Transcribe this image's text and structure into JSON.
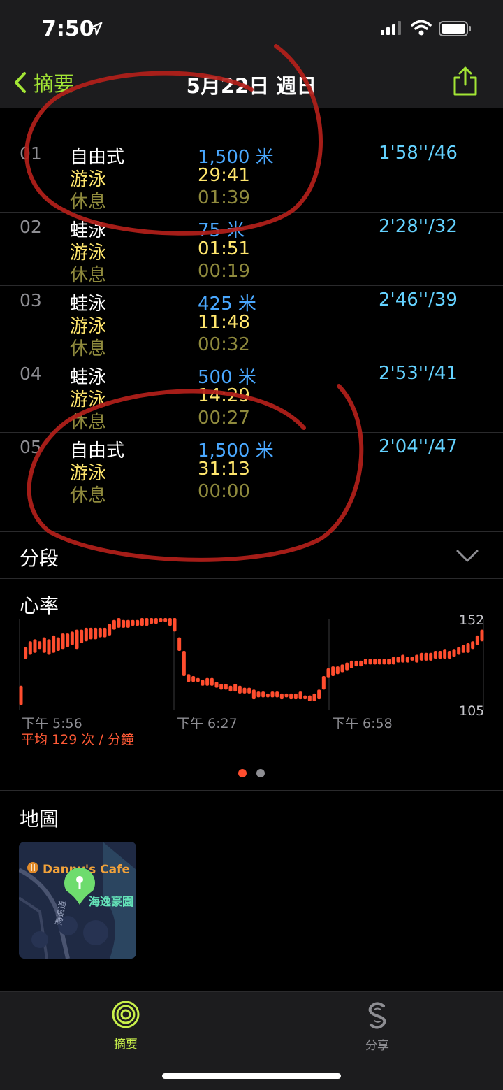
{
  "status": {
    "time": "7:50"
  },
  "nav": {
    "back_label": "摘要",
    "title": "5月22日 週日"
  },
  "laps": [
    {
      "num": "01",
      "stroke": "自由式",
      "distance": "1,500 米",
      "swim_label": "游泳",
      "swim_time": "29:41",
      "rest_label": "休息",
      "rest_time": "01:39",
      "pace": "1'58''/46"
    },
    {
      "num": "02",
      "stroke": "蛙泳",
      "distance": "75 米",
      "swim_label": "游泳",
      "swim_time": "01:51",
      "rest_label": "休息",
      "rest_time": "00:19",
      "pace": "2'28''/32"
    },
    {
      "num": "03",
      "stroke": "蛙泳",
      "distance": "425 米",
      "swim_label": "游泳",
      "swim_time": "11:48",
      "rest_label": "休息",
      "rest_time": "00:32",
      "pace": "2'46''/39"
    },
    {
      "num": "04",
      "stroke": "蛙泳",
      "distance": "500 米",
      "swim_label": "游泳",
      "swim_time": "14:29",
      "rest_label": "休息",
      "rest_time": "00:27",
      "pace": "2'53''/41"
    },
    {
      "num": "05",
      "stroke": "自由式",
      "distance": "1,500 米",
      "swim_label": "游泳",
      "swim_time": "31:13",
      "rest_label": "休息",
      "rest_time": "00:00",
      "pace": "2'04''/47"
    }
  ],
  "segments": {
    "label": "分段"
  },
  "heart_rate": {
    "title": "心率",
    "max_label": "152",
    "min_label": "105",
    "ticks": [
      "下午 5:56",
      "下午 6:27",
      "下午 6:58"
    ],
    "average": "平均 129 次 / 分鐘",
    "color": "#ff4d2e"
  },
  "chart_data": {
    "type": "bar",
    "title": "心率",
    "ylim": [
      105,
      152
    ],
    "ytick_labels": [
      "152",
      "105"
    ],
    "xtick_labels": [
      "下午 5:56",
      "下午 6:27",
      "下午 6:58"
    ],
    "series": [
      {
        "ranges": [
          [
            107,
            117
          ],
          [
            131,
            137
          ],
          [
            133,
            140
          ],
          [
            134,
            141
          ],
          [
            136,
            140
          ],
          [
            134,
            142
          ],
          [
            133,
            141
          ],
          [
            134,
            143
          ],
          [
            135,
            142
          ],
          [
            136,
            144
          ],
          [
            137,
            144
          ],
          [
            138,
            145
          ],
          [
            136,
            146
          ],
          [
            139,
            146
          ],
          [
            140,
            147
          ],
          [
            141,
            147
          ],
          [
            141,
            147
          ],
          [
            142,
            147
          ],
          [
            142,
            147
          ],
          [
            143,
            149
          ],
          [
            146,
            151
          ],
          [
            147,
            152
          ],
          [
            147,
            151
          ],
          [
            147,
            151
          ],
          [
            148,
            151
          ],
          [
            148,
            151
          ],
          [
            148,
            152
          ],
          [
            148,
            152
          ],
          [
            149,
            152
          ],
          [
            149,
            152
          ],
          [
            150,
            152
          ],
          [
            150,
            152
          ],
          [
            148,
            152
          ],
          [
            145,
            152
          ],
          [
            135,
            142
          ],
          [
            122,
            135
          ],
          [
            119,
            123
          ],
          [
            119,
            122
          ],
          [
            119,
            121
          ],
          [
            117,
            120
          ],
          [
            117,
            121
          ],
          [
            117,
            121
          ],
          [
            116,
            119
          ],
          [
            115,
            118
          ],
          [
            115,
            118
          ],
          [
            114,
            117
          ],
          [
            114,
            118
          ],
          [
            113,
            117
          ],
          [
            113,
            116
          ],
          [
            113,
            116
          ],
          [
            110,
            115
          ],
          [
            111,
            114
          ],
          [
            111,
            114
          ],
          [
            111,
            113
          ],
          [
            111,
            114
          ],
          [
            111,
            114
          ],
          [
            110,
            113
          ],
          [
            111,
            113
          ],
          [
            110,
            113
          ],
          [
            110,
            113
          ],
          [
            110,
            114
          ],
          [
            110,
            112
          ],
          [
            109,
            112
          ],
          [
            109,
            113
          ],
          [
            110,
            115
          ],
          [
            115,
            122
          ],
          [
            121,
            126
          ],
          [
            122,
            127
          ],
          [
            123,
            127
          ],
          [
            124,
            128
          ],
          [
            125,
            129
          ],
          [
            126,
            130
          ],
          [
            127,
            130
          ],
          [
            127,
            130
          ],
          [
            128,
            131
          ],
          [
            128,
            131
          ],
          [
            128,
            131
          ],
          [
            128,
            131
          ],
          [
            128,
            131
          ],
          [
            128,
            131
          ],
          [
            128,
            132
          ],
          [
            129,
            132
          ],
          [
            129,
            133
          ],
          [
            129,
            132
          ],
          [
            130,
            132
          ],
          [
            129,
            133
          ],
          [
            130,
            134
          ],
          [
            130,
            134
          ],
          [
            130,
            134
          ],
          [
            131,
            135
          ],
          [
            131,
            135
          ],
          [
            131,
            136
          ],
          [
            131,
            135
          ],
          [
            132,
            136
          ],
          [
            133,
            137
          ],
          [
            134,
            138
          ],
          [
            134,
            139
          ],
          [
            136,
            140
          ],
          [
            138,
            143
          ],
          [
            140,
            146
          ]
        ]
      }
    ]
  },
  "pager": {
    "active": "#ff4d2e",
    "inactive": "#8e8e93"
  },
  "map": {
    "title": "地圖",
    "place": "Danny's Cafe",
    "label": "海逸豪園",
    "road": "海逸道"
  },
  "tabs": [
    {
      "label": "摘要",
      "icon": "activity-rings-icon",
      "color": "#c8f04a"
    },
    {
      "label": "分享",
      "icon": "sharing-icon",
      "color": "#8e8e93"
    }
  ],
  "accent": "#a3e635"
}
